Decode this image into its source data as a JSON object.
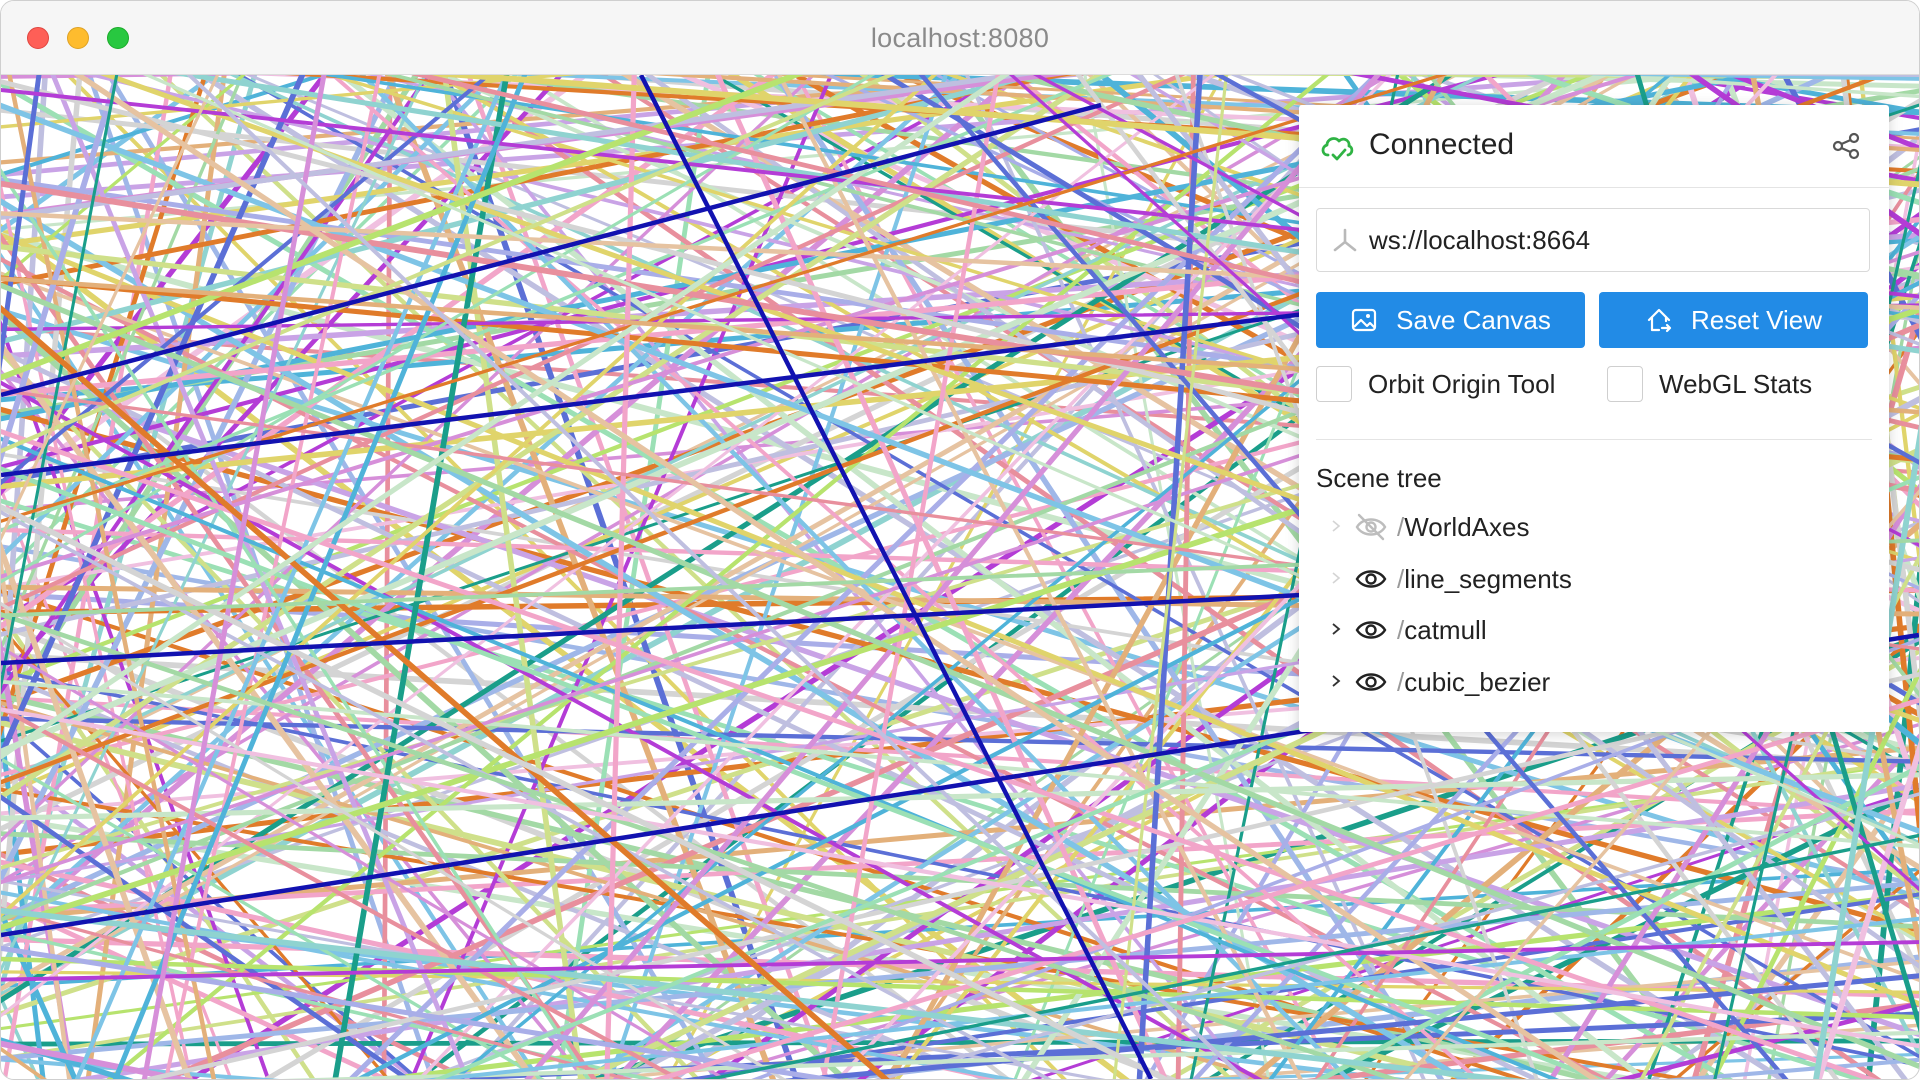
{
  "window": {
    "title": "localhost:8080"
  },
  "panel": {
    "status": "Connected",
    "server_url": "ws://localhost:8664",
    "buttons": {
      "save_canvas": "Save Canvas",
      "reset_view": "Reset View"
    },
    "checkboxes": {
      "orbit_origin_tool": {
        "label": "Orbit Origin Tool",
        "checked": false
      },
      "webgl_stats": {
        "label": "WebGL Stats",
        "checked": false
      }
    },
    "scene_tree": {
      "title": "Scene tree",
      "nodes": [
        {
          "name": "WorldAxes",
          "visible": false,
          "has_children": false
        },
        {
          "name": "line_segments",
          "visible": true,
          "has_children": false
        },
        {
          "name": "catmull",
          "visible": true,
          "has_children": true
        },
        {
          "name": "cubic_bezier",
          "visible": true,
          "has_children": true
        }
      ]
    }
  },
  "colors": {
    "accent": "#228be6",
    "connected": "#2fb344"
  },
  "icons": {
    "status": "cloud-check-icon",
    "share": "share-icon",
    "server": "plug-icon",
    "save": "photo-icon",
    "reset": "home-move-icon",
    "visible": "eye-icon",
    "hidden": "eye-off-icon"
  }
}
